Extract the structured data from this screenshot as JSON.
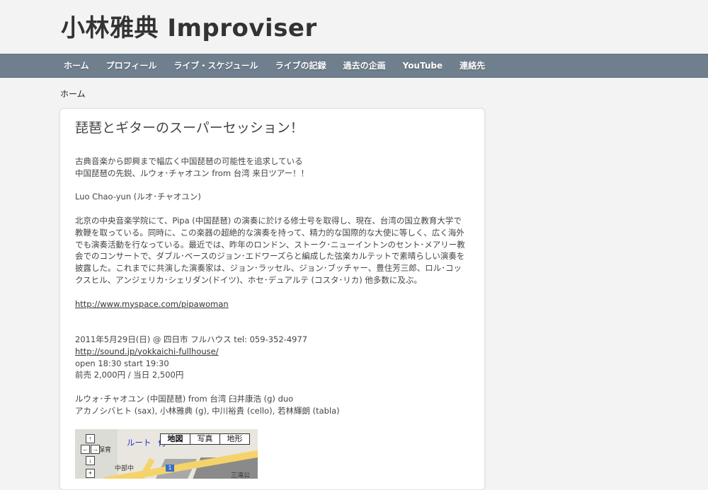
{
  "site": {
    "title": "小林雅典 Improviser"
  },
  "nav": {
    "items": [
      {
        "label": "ホーム"
      },
      {
        "label": "プロフィール"
      },
      {
        "label": "ライブ・スケジュール"
      },
      {
        "label": "ライブの記録"
      },
      {
        "label": "過去の企画"
      },
      {
        "label": "YouTube"
      },
      {
        "label": "連絡先"
      }
    ]
  },
  "breadcrumb": {
    "label": "ホーム"
  },
  "post": {
    "title": "琵琶とギターのスーパーセッション！",
    "intro_line1": "古典音楽から即興まで幅広く中国琵琶の可能性を追求している",
    "intro_line2": "中国琵琶の先鋭、ルウォ･チャオユン from 台湾 来日ツアー！！",
    "artist_name": "Luo Chao-yun (ルオ･チャオユン)",
    "bio": "北京の中央音楽学院にて、Pipa (中国琵琶) の演奏に於ける修士号を取得し、現在、台湾の国立教育大学で教鞭を取っている。同時に、この楽器の超絶的な演奏を持って、精力的な国際的な大使に等しく、広く海外でも演奏活動を行なっている。最近では、昨年のロンドン、ストーク･ニューイントンのセント･メアリー教会でのコンサートで、ダブル･ベースのジョン･エドワーズらと編成した弦楽カルテットで素晴らしい演奏を披露した。これまでに共演した演奏家は、ジョン･ラッセル、ジョン･ブッチャー、豊住芳三郎、ロル･コックスヒル、アンジェリカ･シェリダン(ドイツ)、ホセ･デュアルテ (コスタ･リカ) 他多数に及ぶ。",
    "myspace_link": "http://www.myspace.com/pipawoman",
    "event_date": "2011年5月29日(日) @ 四日市 フルハウス tel: 059-352-4977",
    "venue_link": "http://sound.jp/yokkaichi-fullhouse/",
    "open_time": "open 18:30 start 19:30",
    "price": "前売 2,000円 / 当日 2,500円",
    "lineup_line1": "ルウォ･チャオユン (中国琵琶) from 台湾 臼井康浩 (g) duo",
    "lineup_line2": "アカノシバヒト (sax), 小林雅典 (g), 中川裕貴 (cello), 若林輝朗 (tabla)"
  },
  "map": {
    "route_label": "ルート",
    "route_extra": "付",
    "type_buttons": [
      "地図",
      "写真",
      "地形"
    ],
    "labels": {
      "hoikuen": "保育",
      "chubu": "中部中",
      "sannotaki": "三滝公",
      "route_no": "1"
    },
    "controls": {
      "up": "↑",
      "left": "←",
      "right": "→",
      "down": "↓",
      "zoom_in": "+"
    }
  }
}
